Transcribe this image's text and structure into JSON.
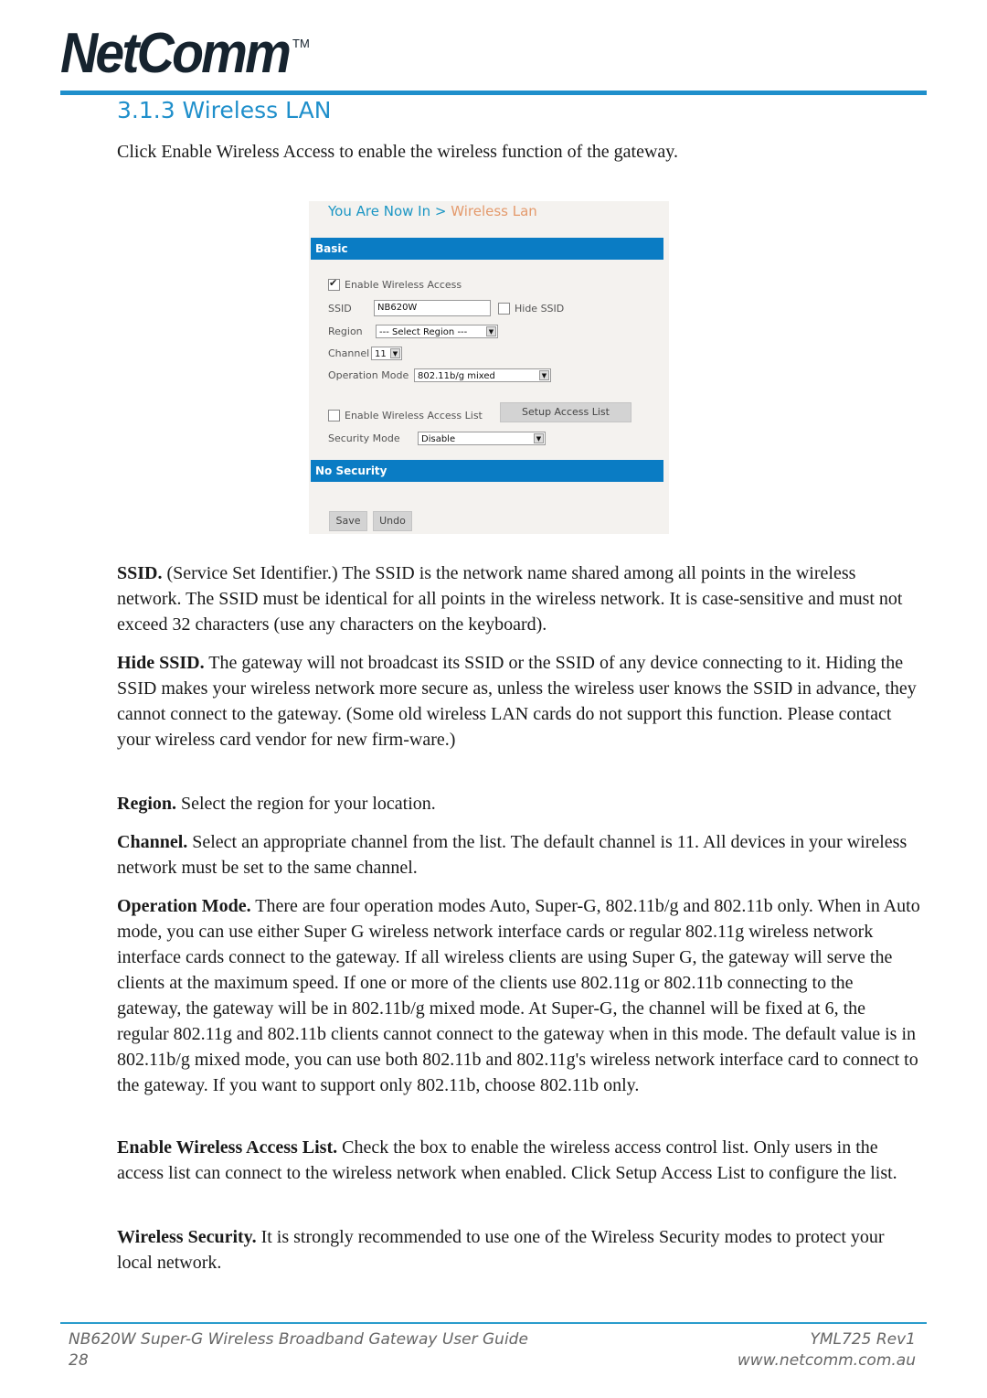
{
  "header": {
    "logo_text": "NetComm",
    "logo_tm": "TM",
    "section_title": "3.1.3 Wireless LAN",
    "intro": "Click Enable Wireless Access to enable the wireless function of the gateway."
  },
  "screenshot": {
    "breadcrumb_prefix": "You Are Now In >",
    "breadcrumb_current": "Wireless Lan",
    "basic_header": "Basic",
    "enable_wireless_access": {
      "label": "Enable Wireless Access",
      "checked": true
    },
    "ssid": {
      "label": "SSID",
      "value": "NB620W"
    },
    "hide_ssid": {
      "label": "Hide SSID",
      "checked": false
    },
    "region": {
      "label": "Region",
      "value": "--- Select Region ---"
    },
    "channel": {
      "label": "Channel",
      "value": "11"
    },
    "operation_mode": {
      "label": "Operation Mode",
      "value": "802.11b/g mixed"
    },
    "enable_access_list": {
      "label": "Enable Wireless Access List",
      "checked": false
    },
    "setup_access_list_label": "Setup Access List",
    "security_mode": {
      "label": "Security Mode",
      "value": "Disable"
    },
    "no_security_header": "No Security",
    "save_label": "Save",
    "undo_label": "Undo",
    "accent_color": "#0a7cc4"
  },
  "paragraphs": [
    {
      "term": "SSID.",
      "text": " (Service Set Identifier.) The SSID is the network name shared among all points in the wireless network. The SSID must be identical for all points in the wireless network. It is case-sensitive and must not exceed 32 characters (use any characters on the keyboard)."
    },
    {
      "term": "Hide SSID.",
      "text": " The gateway will not broadcast its SSID or the SSID of any device connecting to it. Hiding the SSID makes your wireless network more secure as, unless the wireless user knows the SSID in advance, they cannot connect to the gateway. (Some old wireless LAN cards do not support this function. Please contact your wireless card vendor for new firm-ware.)"
    },
    {
      "term": "Region.",
      "text": " Select the region for your location."
    },
    {
      "term": "Channel.",
      "text": " Select an appropriate channel from the list. The default channel is 11. All devices in your wireless network must be set to the same channel."
    },
    {
      "term": "Operation Mode.",
      "text": " There are four operation modes Auto, Super-G, 802.11b/g and 802.11b only. When in Auto mode, you can use either Super G wireless network interface cards or regular 802.11g wireless network interface cards connect to the gateway. If all wireless clients are using Super G, the gateway will serve the clients at the maximum speed. If one or more of the clients use 802.11g or 802.11b connecting to the gateway, the gateway will be in 802.11b/g mixed mode.  At Super-G, the channel will be fixed at 6, the regular 802.11g and 802.11b clients cannot connect to the gateway when in this mode. The default value is in 802.11b/g mixed mode, you can use both 802.11b and 802.11g's wireless network interface card to connect to the gateway. If you want to support only 802.11b, choose 802.11b only."
    },
    {
      "term": "Enable Wireless Access List.",
      "text": " Check the box to enable the wireless access control list. Only users in the access list can connect to the wireless network when enabled. Click Setup Access List to configure the list."
    },
    {
      "term": "Wireless Security.",
      "text": " It is strongly recommended to use one of the Wireless Security modes to protect your local network."
    }
  ],
  "footer": {
    "guide_title": "NB620W Super-G Wireless Broadband  Gateway User Guide",
    "page_number": "28",
    "doc_code": "YML725 Rev1",
    "website": "www.netcomm.com.au"
  }
}
